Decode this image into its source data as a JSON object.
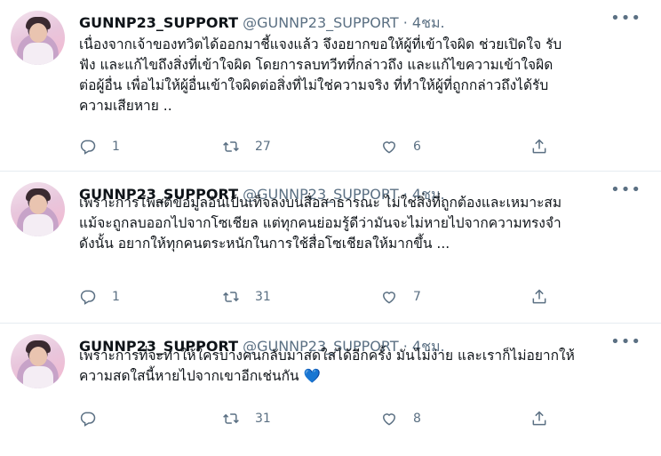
{
  "tweets": [
    {
      "name": "GUNNP23_SUPPORT",
      "handle": "@GUNNP23_SUPPORT",
      "time": "4ชม.",
      "text": "เนื่องจากเจ้าของทวิตได้ออกมาชี้แจงแล้ว จึงอยากขอให้ผู้ที่เข้าใจผิด ช่วยเปิดใจ รับ\nฟัง และแก้ไขถึงสิ่งที่เข้าใจผิด โดยการลบทวีทที่กล่าวถึง และแก้ไขความเข้าใจผิด\nต่อผู้อื่น เพื่อไม่ให้ผู้อื่นเข้าใจผิดต่อสิ่งที่ไม่ใช่ความจริง ที่ทำให้ผู้ที่ถูกกล่าวถึงได้รับ\nความเสียหาย ..",
      "replies": "1",
      "retweets": "27",
      "likes": "6"
    },
    {
      "name": "GUNNP23_SUPPORT",
      "handle": "@GUNNP23_SUPPORT",
      "time": "4ชม.",
      "text": "เพราะการโพสต์ข้อมูลอันเป็นเท็จลงบนสื่อสาธารณะ ไม่ใช่สิ่งที่ถูกต้องและเหมาะสม\nแม้จะถูกลบออกไปจากโซเชียล แต่ทุกคนย่อมรู้ดีว่ามันจะไม่หายไปจากความทรงจำ\nดังนั้น อยากให้ทุกคนตระหนักในการใช้สื่อโซเชียลให้มากขึ้น ...",
      "replies": "1",
      "retweets": "31",
      "likes": "7"
    },
    {
      "name": "GUNNP23_SUPPORT",
      "handle": "@GUNNP23_SUPPORT",
      "time": "4ชม.",
      "text": "เพราะการที่จะทำให้ใครบางคนกลับมาสดใสได้อีกครั้ง มันไม่ง่าย และเราก็ไม่อยากให้\nความสดใสนี้หายไปจากเขาอีกเช่นกัน",
      "emoji": "💙",
      "replies": "",
      "retweets": "31",
      "likes": "8"
    }
  ],
  "icons": {
    "reply": "reply-icon",
    "retweet": "retweet-icon",
    "like": "heart-icon",
    "share": "share-icon",
    "more": "more-icon"
  },
  "colors": {
    "secondary_text": "#5b7083",
    "divider": "#e6ecf0",
    "heart_emoji": "#5dadec"
  }
}
